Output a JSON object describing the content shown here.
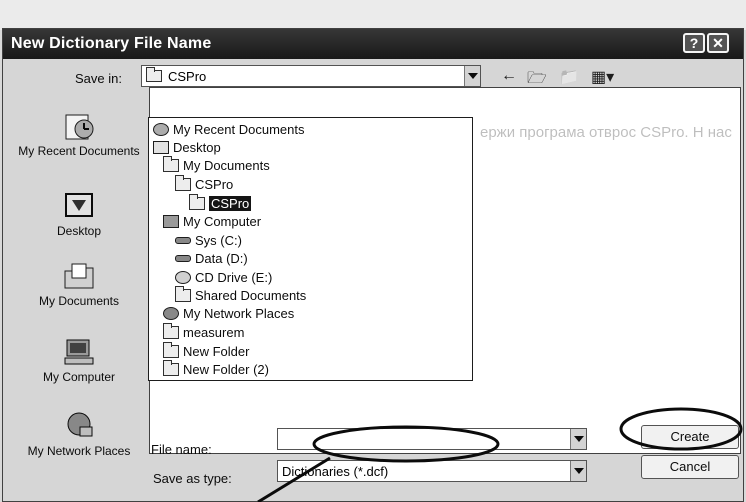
{
  "dialog": {
    "title": "New Dictionary File Name",
    "help_button": "?",
    "close_button": "✕"
  },
  "save_in": {
    "label": "Save in:",
    "value": "CSPro"
  },
  "places": [
    {
      "label": "My Recent Documents",
      "icon": "recent-documents-icon"
    },
    {
      "label": "Desktop",
      "icon": "desktop-icon"
    },
    {
      "label": "My Documents",
      "icon": "my-documents-icon"
    },
    {
      "label": "My Computer",
      "icon": "my-computer-icon"
    },
    {
      "label": "My Network Places",
      "icon": "network-places-icon"
    }
  ],
  "dropdown_items": [
    {
      "label": "My Recent Documents",
      "icon": "recent-documents-icon",
      "selected": false
    },
    {
      "label": "Desktop",
      "icon": "desktop-icon",
      "selected": false
    },
    {
      "label": "My Documents",
      "icon": "folder-icon",
      "selected": false
    },
    {
      "label": "CSPro",
      "icon": "folder-icon",
      "selected": false
    },
    {
      "label": "CSPro",
      "icon": "folder-open-icon",
      "selected": true
    },
    {
      "label": "My Computer",
      "icon": "computer-icon",
      "selected": false
    },
    {
      "label": "Sys (C:)",
      "icon": "drive-icon",
      "selected": false
    },
    {
      "label": "Data (D:)",
      "icon": "drive-icon",
      "selected": false
    },
    {
      "label": "CD Drive (E:)",
      "icon": "cd-drive-icon",
      "selected": false
    },
    {
      "label": "Shared Documents",
      "icon": "folder-icon",
      "selected": false
    },
    {
      "label": "My Network Places",
      "icon": "network-places-icon",
      "selected": false
    },
    {
      "label": "measurem",
      "icon": "folder-icon",
      "selected": false
    },
    {
      "label": "New Folder",
      "icon": "folder-icon",
      "selected": false
    },
    {
      "label": "New Folder (2)",
      "icon": "folder-icon",
      "selected": false
    }
  ],
  "file_name": {
    "label": "File name:",
    "value": ""
  },
  "save_as_type": {
    "label": "Save as type:",
    "value": "Dictionaries (*.dcf)"
  },
  "buttons": {
    "create": "Create",
    "cancel": "Cancel"
  },
  "background_text": "ержи програма отврос CSPro. Н нас"
}
